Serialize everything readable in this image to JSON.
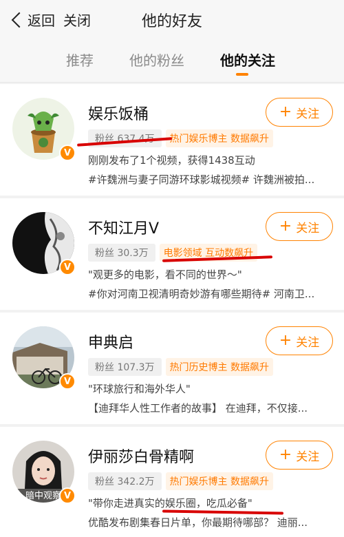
{
  "header": {
    "back_label": "返回",
    "close_label": "关闭",
    "title": "他的好友"
  },
  "tabs": [
    {
      "label": "推荐"
    },
    {
      "label": "他的粉丝"
    },
    {
      "label": "他的关注"
    }
  ],
  "follow_label": "关注",
  "users": [
    {
      "name": "娱乐饭桶",
      "fans": "粉丝 637.4万",
      "tag": "热门娱乐博主 数据飙升",
      "line1": "刚刚发布了1个视频，获得1438互动",
      "line2": "#许魏洲与妻子同游环球影城视频# 许魏洲被拍..."
    },
    {
      "name": "不知江月V",
      "fans": "粉丝 30.3万",
      "tag": "电影领域 互动数飙升",
      "line1": "\"观更多的电影，看不同的世界～\"",
      "line2": "#你对河南卫视清明奇妙游有哪些期待# 河南卫..."
    },
    {
      "name": "申典启",
      "fans": "粉丝 107.3万",
      "tag": "热门历史博主 数据飙升",
      "line1": "\"环球旅行和海外华人\"",
      "line2": "【迪拜华人性工作者的故事】 在迪拜，不仅接..."
    },
    {
      "name": "伊丽莎白骨精啊",
      "fans": "粉丝 342.2万",
      "tag": "热门娱乐博主 数据飙升",
      "line1": "\"带你走进真实的娱乐圈，吃瓜必备\"",
      "line2": "优酷发布剧集春日片单，你最期待哪部？ 迪丽..."
    }
  ],
  "avatar_overlay_text": "暗中观察",
  "colors": {
    "accent": "#ff8200",
    "verified": "#ff8a00",
    "highlight_mark": "#d80000"
  }
}
